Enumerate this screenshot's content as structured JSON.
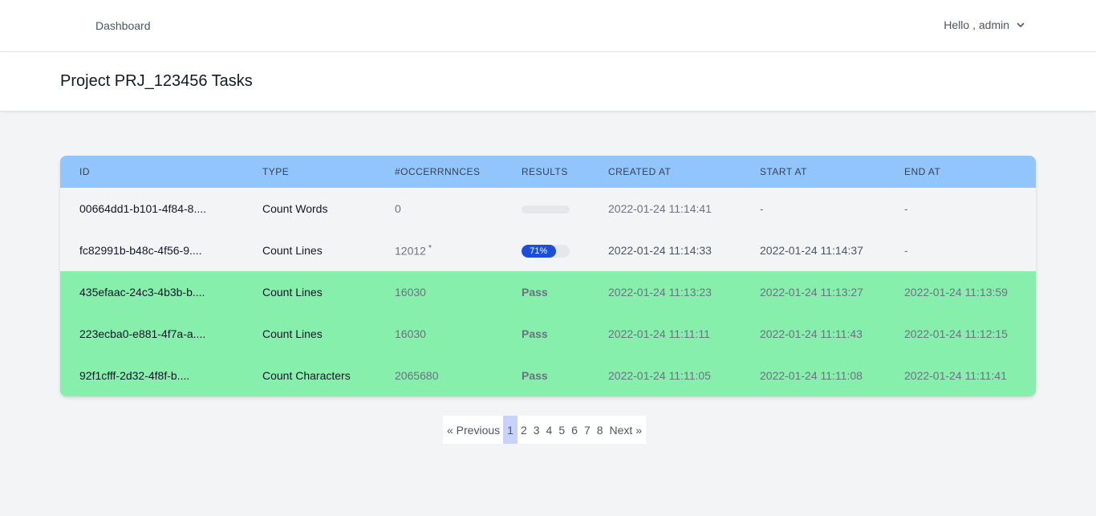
{
  "nav": {
    "dashboard_label": "Dashboard",
    "user_greeting": "Hello , admin"
  },
  "header": {
    "title": "Project PRJ_123456 Tasks"
  },
  "table": {
    "columns": [
      "ID",
      "TYPE",
      "#OCCERRNNCES",
      "RESULTS",
      "CREATED AT",
      "START AT",
      "END AT"
    ],
    "rows": [
      {
        "id": "00664dd1-b101-4f84-8....",
        "type": "Count Words",
        "occurrences": "0",
        "progress": 0,
        "progress_label": "",
        "created": "2022-01-24 11:14:41",
        "start": "-",
        "end": "-"
      },
      {
        "id": "fc82991b-b48c-4f56-9....",
        "type": "Count Lines",
        "occurrences": "12012",
        "occurrences_mark": "*",
        "progress": 71,
        "progress_label": "71%",
        "created": "2022-01-24 11:14:33",
        "start": "2022-01-24 11:14:37",
        "end": "-"
      },
      {
        "id": "435efaac-24c3-4b3b-b....",
        "type": "Count Lines",
        "occurrences": "16030",
        "result": "Pass",
        "created": "2022-01-24 11:13:23",
        "start": "2022-01-24 11:13:27",
        "end": "2022-01-24 11:13:59"
      },
      {
        "id": "223ecba0-e881-4f7a-a....",
        "type": "Count Lines",
        "occurrences": "16030",
        "result": "Pass",
        "created": "2022-01-24 11:11:11",
        "start": "2022-01-24 11:11:43",
        "end": "2022-01-24 11:12:15"
      },
      {
        "id": "92f1cfff-2d32-4f8f-b....",
        "type": "Count Characters",
        "occurrences": "2065680",
        "result": "Pass",
        "created": "2022-01-24 11:11:05",
        "start": "2022-01-24 11:11:08",
        "end": "2022-01-24 11:11:41"
      }
    ]
  },
  "pagination": {
    "previous": "« Previous",
    "pages": [
      "1",
      "2",
      "3",
      "4",
      "5",
      "6",
      "7",
      "8"
    ],
    "next": "Next »",
    "current": "1"
  },
  "colors": {
    "header_row": "#93c5fd",
    "pass_row": "#86efac",
    "progress": "#1d4ed8"
  }
}
